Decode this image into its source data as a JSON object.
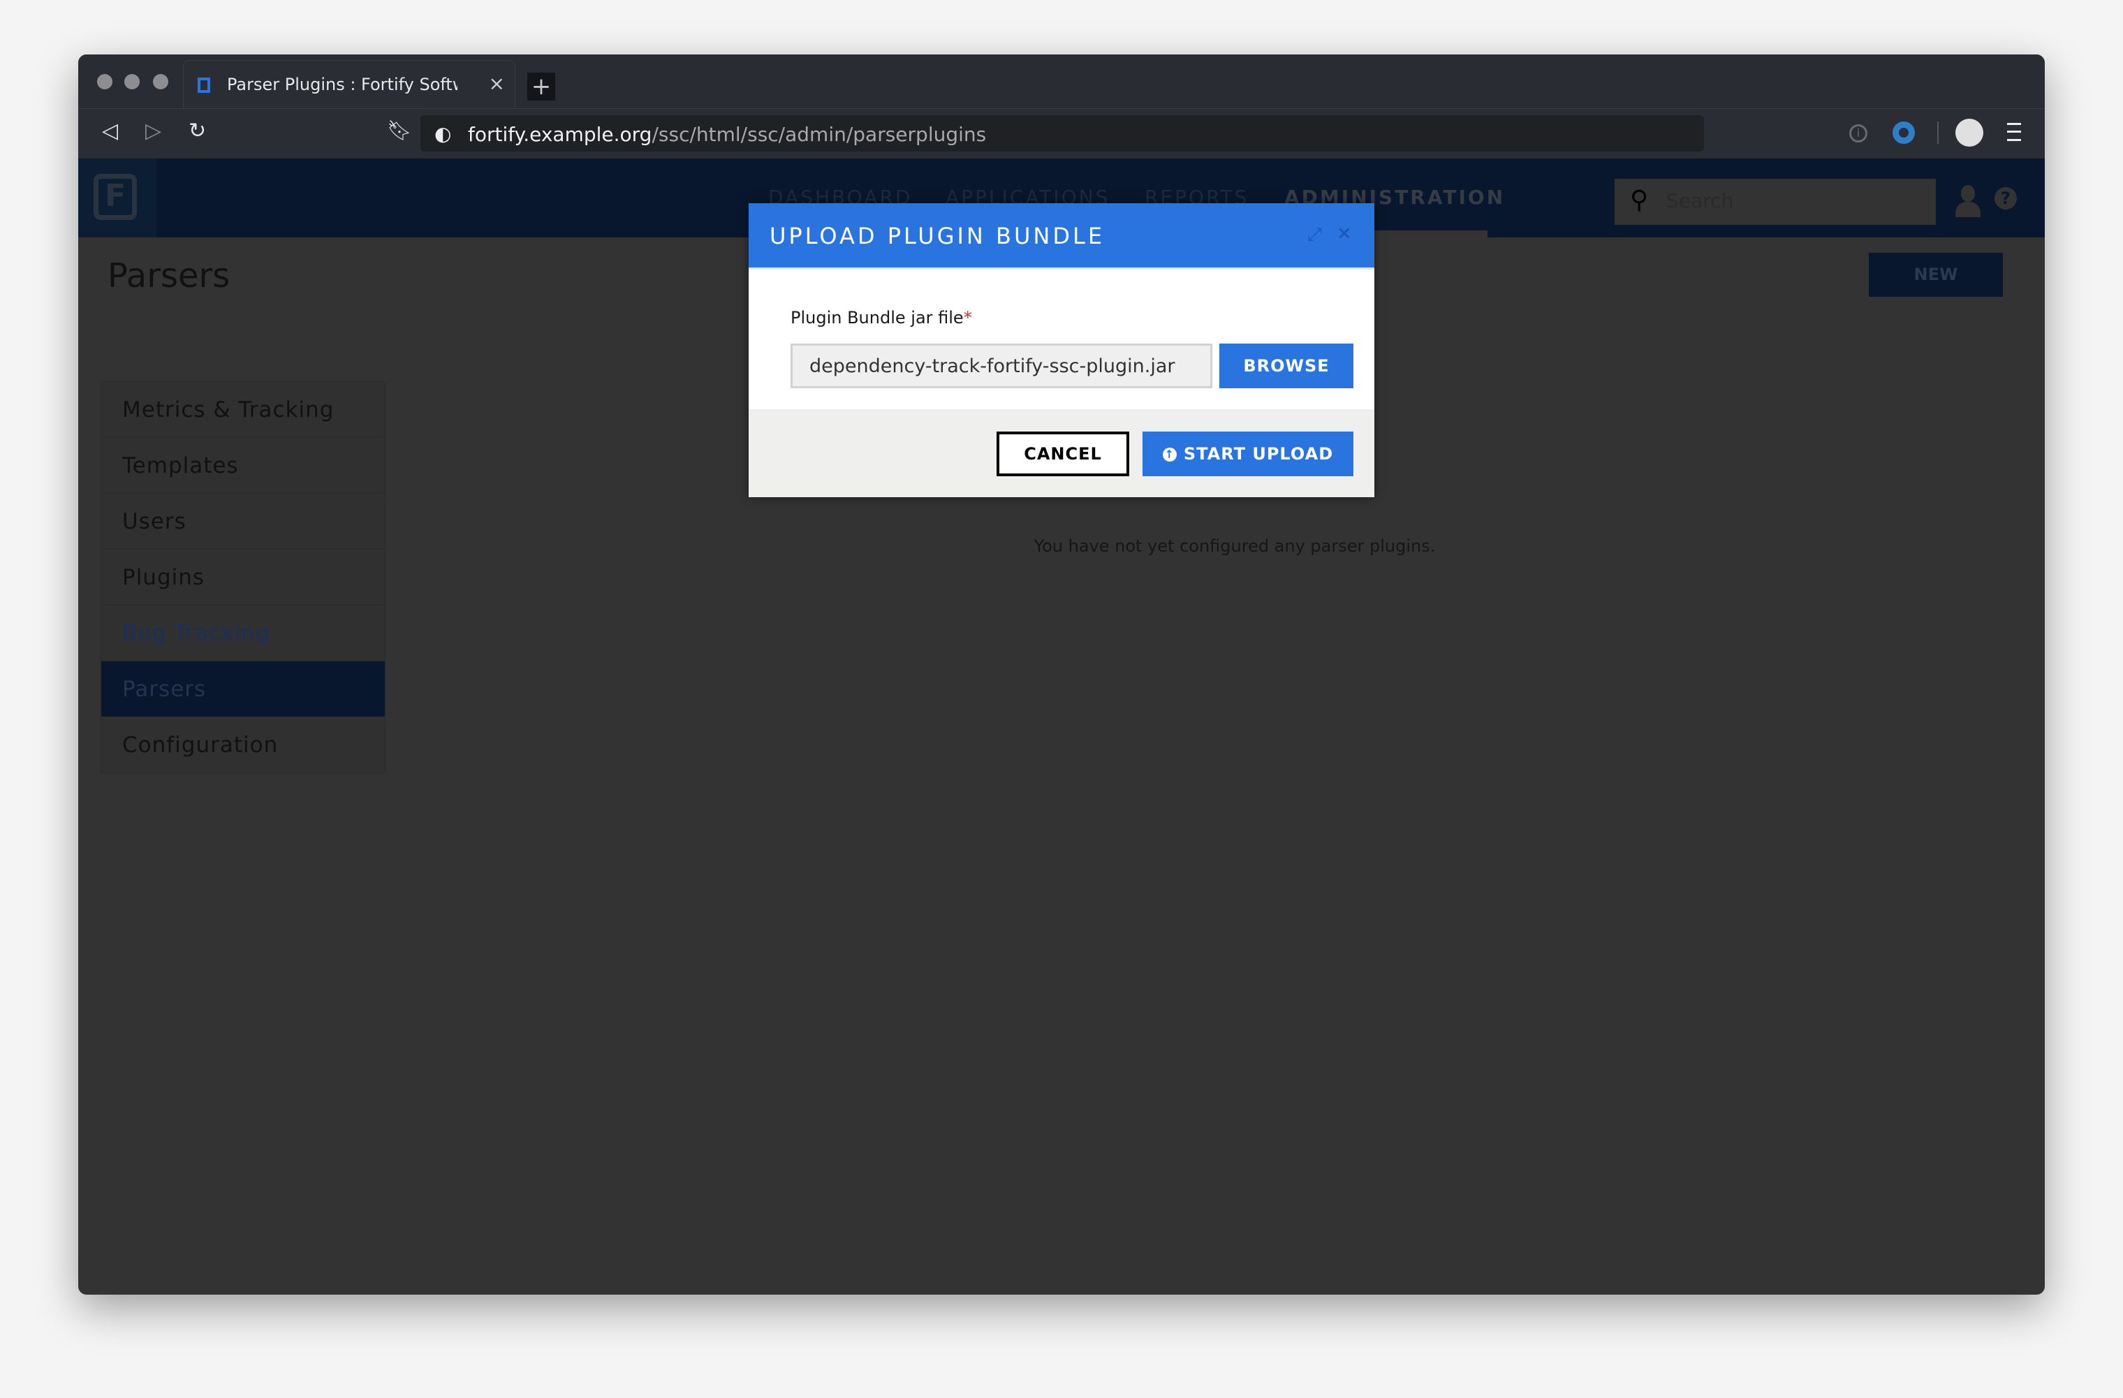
{
  "browser": {
    "tab_title": "Parser Plugins : Fortify Software",
    "tab_close": "×",
    "new_tab": "+",
    "url_host": "fortify.example.org",
    "url_path": "/ssc/html/ssc/admin/parserplugins",
    "icons": [
      "back-icon",
      "forward-icon",
      "reload-icon",
      "bookmark-icon",
      "globe-icon",
      "info-icon",
      "extension-ring-icon",
      "profile-avatar-icon",
      "menu-icon"
    ]
  },
  "header": {
    "logo_letter": "F",
    "nav": [
      "DASHBOARD",
      "APPLICATIONS",
      "REPORTS",
      "ADMINISTRATION"
    ],
    "active_nav": "ADMINISTRATION",
    "search_placeholder": "Search",
    "help": "?"
  },
  "page": {
    "title": "Parsers",
    "new_label": "NEW",
    "empty_message": "You have not yet configured any parser plugins."
  },
  "sidebar": {
    "items": [
      {
        "label": "Metrics & Tracking"
      },
      {
        "label": "Templates"
      },
      {
        "label": "Users"
      },
      {
        "label": "Plugins"
      },
      {
        "label": "Bug Tracking"
      },
      {
        "label": "Parsers"
      },
      {
        "label": "Configuration"
      }
    ],
    "active": "Parsers"
  },
  "modal": {
    "title": "UPLOAD PLUGIN BUNDLE",
    "field_label": "Plugin Bundle jar file",
    "required_mark": "*",
    "file_value": "dependency-track-fortify-ssc-plugin.jar",
    "browse_label": "BROWSE",
    "cancel_label": "CANCEL",
    "upload_label": "START UPLOAD",
    "close": "×",
    "expand": "⤢"
  },
  "colors": {
    "accent": "#2a74e0",
    "header": "#08172e",
    "required": "#e0252a"
  }
}
